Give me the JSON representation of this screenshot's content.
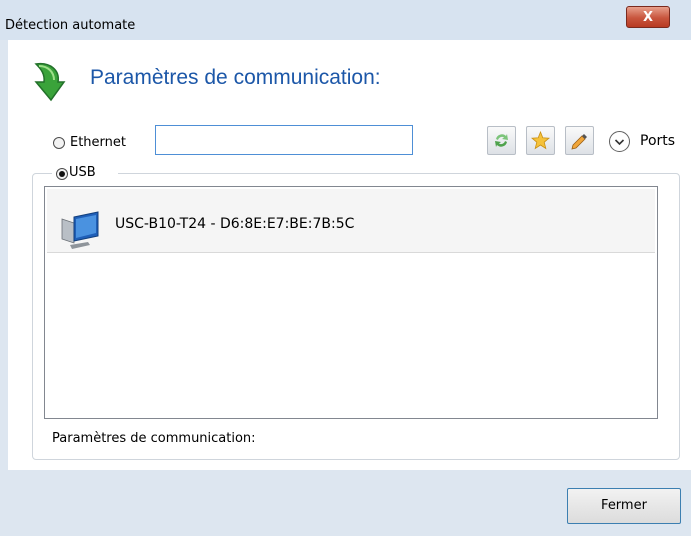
{
  "window": {
    "title": "Détection automate",
    "close_glyph": "X"
  },
  "header": {
    "title": "Paramètres de communication:",
    "icon": "green-arrow-download-icon"
  },
  "ethernet": {
    "label": "Ethernet",
    "selected": false,
    "value": ""
  },
  "toolbar": {
    "buttons": [
      "refresh-icon",
      "star-icon",
      "edit-pencil-icon"
    ],
    "ports_label": "Ports",
    "ports_icon": "chevron-down-icon"
  },
  "usb": {
    "label": "USB",
    "selected": true,
    "devices": [
      {
        "name": "USC-B10-T24 - D6:8E:E7:BE:7B:5C",
        "icon": "computer-monitor-icon"
      }
    ]
  },
  "status": {
    "text": "Paramètres de communication:"
  },
  "footer": {
    "close_label": "Fermer"
  },
  "colors": {
    "accent": "#1c57a8",
    "close_button": "#c8553d",
    "focus_border": "#4e8fd6"
  }
}
